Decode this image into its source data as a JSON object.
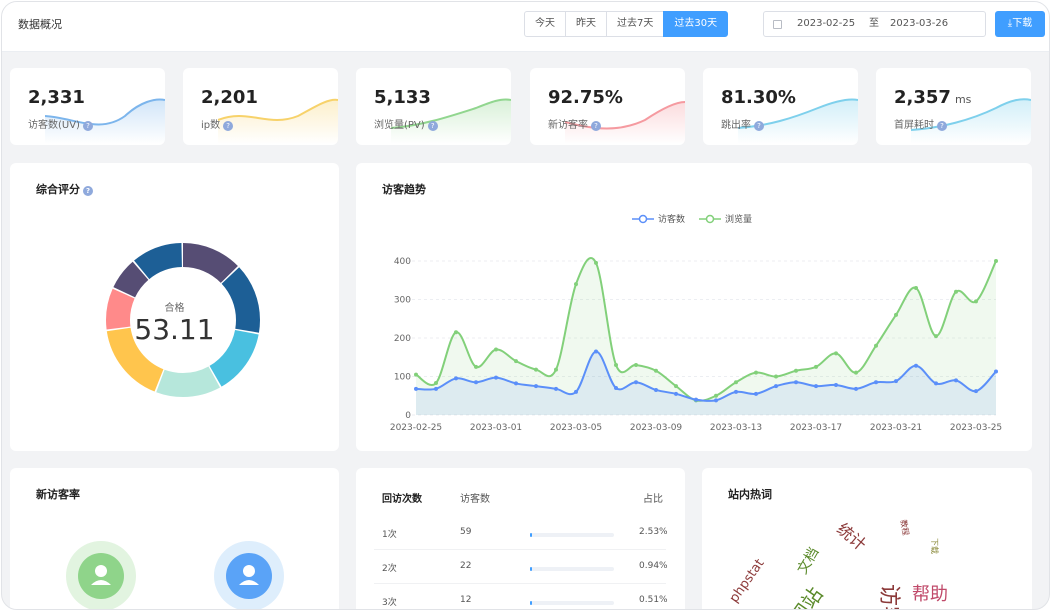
{
  "header": {
    "title": "数据概况",
    "ranges": [
      "今天",
      "昨天",
      "过去7天",
      "过去30天"
    ],
    "active_range": 3,
    "date_start": "2023-02-25",
    "date_sep": "至",
    "date_end": "2023-03-26",
    "download_label": "⤓下载",
    "accent_color": "#409eff"
  },
  "stats": [
    {
      "value": "2,331",
      "unit": "",
      "label": "访客数(UV)",
      "color": "#7cb5ec"
    },
    {
      "value": "2,201",
      "unit": "",
      "label": "ip数",
      "color": "#f7d26a"
    },
    {
      "value": "5,133",
      "unit": "",
      "label": "浏览量(PV)",
      "color": "#91d68f"
    },
    {
      "value": "92.75%",
      "unit": "",
      "label": "新访客率",
      "color": "#f59aa0"
    },
    {
      "value": "81.30%",
      "unit": "",
      "label": "跳出率",
      "color": "#7ed0ec"
    },
    {
      "value": "2,357",
      "unit": "ms",
      "label": "首屏耗时",
      "color": "#7ed0ec"
    }
  ],
  "score": {
    "title": "综合评分",
    "center_label": "合格",
    "center_value": "53.11",
    "segment_colors": [
      "#564d74",
      "#1d5f96",
      "#49c0e0",
      "#b6e7db",
      "#ffc54d",
      "#ff8a8a",
      "#564d74",
      "#1d5f96"
    ],
    "segment_shares": [
      0.13,
      0.15,
      0.14,
      0.14,
      0.17,
      0.09,
      0.07,
      0.11
    ]
  },
  "chart_data": {
    "type": "line",
    "title": "访客趋势",
    "x": [
      "2023-02-25",
      "2023-02-26",
      "2023-02-27",
      "2023-02-28",
      "2023-03-01",
      "2023-03-02",
      "2023-03-03",
      "2023-03-04",
      "2023-03-05",
      "2023-03-06",
      "2023-03-07",
      "2023-03-08",
      "2023-03-09",
      "2023-03-10",
      "2023-03-11",
      "2023-03-12",
      "2023-03-13",
      "2023-03-14",
      "2023-03-15",
      "2023-03-16",
      "2023-03-17",
      "2023-03-18",
      "2023-03-19",
      "2023-03-20",
      "2023-03-21",
      "2023-03-22",
      "2023-03-23",
      "2023-03-24",
      "2023-03-25",
      "2023-03-26"
    ],
    "x_tick_labels": [
      "2023-02-25",
      "2023-03-01",
      "2023-03-05",
      "2023-03-09",
      "2023-03-13",
      "2023-03-17",
      "2023-03-21",
      "2023-03-25"
    ],
    "y_ticks": [
      0,
      100,
      200,
      300,
      400
    ],
    "ylim": [
      0,
      400
    ],
    "legend_position": "top-center",
    "series": [
      {
        "name": "访客数",
        "color": "#5b8ff9",
        "values": [
          68,
          68,
          95,
          85,
          97,
          82,
          75,
          68,
          60,
          165,
          70,
          85,
          65,
          55,
          40,
          38,
          60,
          55,
          75,
          85,
          75,
          78,
          68,
          85,
          88,
          128,
          82,
          90,
          62,
          113
        ]
      },
      {
        "name": "浏览量",
        "color": "#82d07a",
        "values": [
          105,
          83,
          215,
          125,
          170,
          140,
          118,
          118,
          340,
          395,
          130,
          130,
          115,
          75,
          38,
          50,
          85,
          110,
          100,
          115,
          125,
          160,
          110,
          180,
          260,
          330,
          205,
          320,
          295,
          400
        ]
      }
    ]
  },
  "new_visitor": {
    "title": "新访客率",
    "colors": [
      "#8fd48a",
      "#5aa3f7"
    ]
  },
  "revisit": {
    "headers": [
      "回访次数",
      "访客数",
      "占比"
    ],
    "rows": [
      {
        "count": "1次",
        "visitors": "59",
        "percent": "2.53%",
        "ratio": 0.0253
      },
      {
        "count": "2次",
        "visitors": "22",
        "percent": "0.94%",
        "ratio": 0.0094
      },
      {
        "count": "3次",
        "visitors": "12",
        "percent": "0.51%",
        "ratio": 0.0051
      }
    ]
  },
  "hotwords": {
    "title": "站内热词",
    "words": [
      {
        "text": "phpstat",
        "color": "#8c3a3a"
      },
      {
        "text": "文档",
        "color": "#5a8a2a"
      },
      {
        "text": "统计",
        "color": "#8c3a3a"
      },
      {
        "text": "帮助",
        "color": "#c04a6a"
      },
      {
        "text": "访客",
        "color": "#8c3a3a"
      },
      {
        "text": "网站",
        "color": "#5a8a2a"
      },
      {
        "text": "教程",
        "color": "#8c3a3a"
      },
      {
        "text": "下载",
        "color": "#8a8a3a"
      }
    ]
  }
}
